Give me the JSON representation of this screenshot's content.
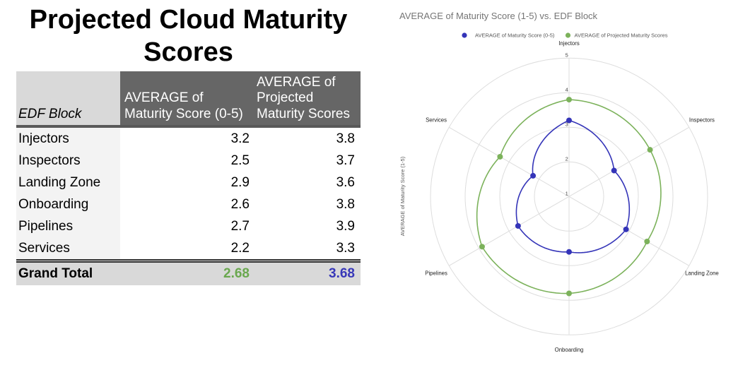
{
  "slide": {
    "title": "Projected Cloud Maturity Scores"
  },
  "table": {
    "headers": [
      "EDF Block",
      "AVERAGE of\nMaturity Score (0-5)",
      "AVERAGE of\nProjected\nMaturity Scores"
    ],
    "rows": [
      {
        "block": "Injectors",
        "current": "3.2",
        "projected": "3.8"
      },
      {
        "block": "Inspectors",
        "current": "2.5",
        "projected": "3.7"
      },
      {
        "block": "Landing Zone",
        "current": "2.9",
        "projected": "3.6"
      },
      {
        "block": "Onboarding",
        "current": "2.6",
        "projected": "3.8"
      },
      {
        "block": "Pipelines",
        "current": "2.7",
        "projected": "3.9"
      },
      {
        "block": "Services",
        "current": "2.2",
        "projected": "3.3"
      }
    ],
    "grand_total": {
      "label": "Grand Total",
      "current": "2.68",
      "projected": "3.68",
      "current_color": "#6aa84f",
      "projected_color": "#3838b8"
    }
  },
  "chart_data": {
    "type": "line",
    "subtype": "radar",
    "title": "AVERAGE of Maturity Score (1-5) vs. EDF Block",
    "xlabel": "",
    "ylabel": "AVERAGE of Maturity Score (1-5)",
    "categories": [
      "Injectors",
      "Inspectors",
      "Landing Zone",
      "Onboarding",
      "Pipelines",
      "Services"
    ],
    "series": [
      {
        "name": "AVERAGE of Maturity Score (0-5)",
        "color": "#3434b8",
        "values": [
          3.2,
          2.5,
          2.9,
          2.6,
          2.7,
          2.2
        ]
      },
      {
        "name": "AVERAGE of Projected Maturity Scores",
        "color": "#7cb25b",
        "values": [
          3.8,
          3.7,
          3.6,
          3.8,
          3.9,
          3.3
        ]
      }
    ],
    "ylim": [
      1,
      5
    ],
    "yticks": [
      "1",
      "2",
      "3",
      "4",
      "5"
    ],
    "grid": true,
    "legend": "top",
    "grid_color": "#dddddd",
    "title_color": "#757575"
  }
}
